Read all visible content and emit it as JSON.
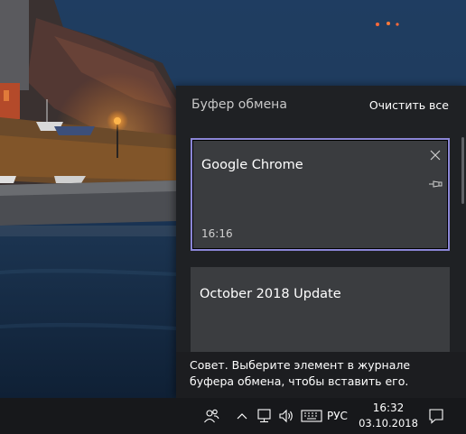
{
  "clipboard": {
    "title": "Буфер обмена",
    "clear_all_label": "Очистить все",
    "items": [
      {
        "text": "Google Chrome",
        "time": "16:16",
        "selected": true
      },
      {
        "text": "October 2018 Update"
      }
    ],
    "tip": "Совет. Выберите элемент в журнале буфера обмена, чтобы вставить его."
  },
  "taskbar": {
    "icons": [
      "people-icon",
      "chevron-up-icon",
      "network-icon",
      "volume-icon",
      "keyboard-icon",
      "notification-icon"
    ],
    "language": "РУС",
    "time": "16:32",
    "date": "03.10.2018"
  },
  "colors": {
    "flyout_bg": "#1f2124",
    "item_bg": "#3a3c3f",
    "selection_border": "#8b86d6",
    "taskbar_bg": "#17181b"
  }
}
